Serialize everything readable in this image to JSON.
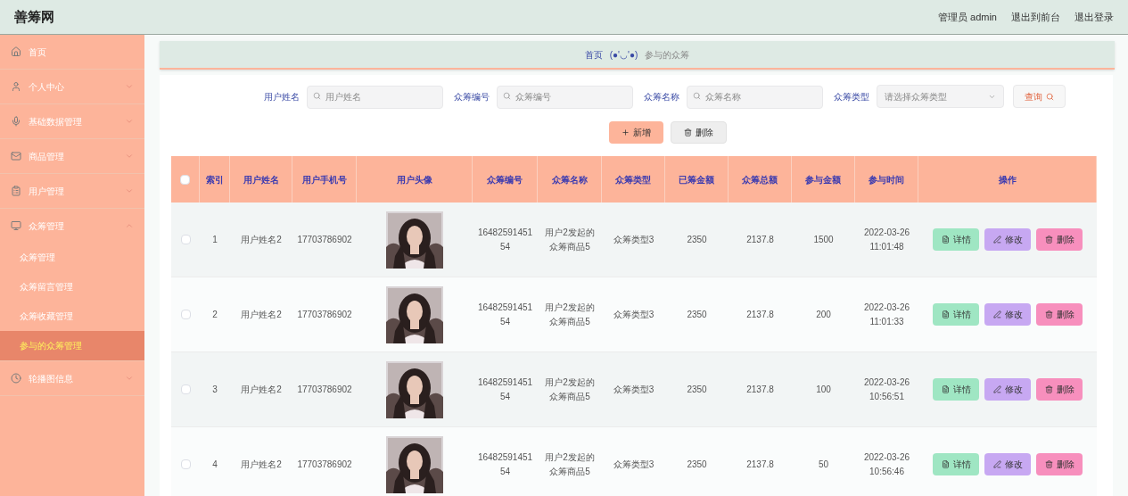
{
  "header": {
    "title": "善筹网",
    "links": [
      "管理员 admin",
      "退出到前台",
      "退出登录"
    ]
  },
  "sidebar": {
    "items": [
      {
        "label": "首页"
      },
      {
        "label": "个人中心",
        "expanded": false
      },
      {
        "label": "基础数据管理",
        "expanded": false
      },
      {
        "label": "商品管理",
        "expanded": false
      },
      {
        "label": "用户管理",
        "expanded": false
      },
      {
        "label": "众筹管理",
        "expanded": true,
        "children": [
          {
            "label": "众筹管理",
            "selected": false
          },
          {
            "label": "众筹留言管理",
            "selected": false
          },
          {
            "label": "众筹收藏管理",
            "selected": false
          },
          {
            "label": "参与的众筹管理",
            "selected": true
          }
        ]
      },
      {
        "label": "轮播图信息",
        "expanded": false
      }
    ]
  },
  "breadcrumb": {
    "home": "首页",
    "separator": "(●'◡'●)",
    "current": "参与的众筹"
  },
  "filters": [
    {
      "kind": "input",
      "label": "用户姓名",
      "placeholder": "用户姓名"
    },
    {
      "kind": "input",
      "label": "众筹编号",
      "placeholder": "众筹编号"
    },
    {
      "kind": "input",
      "label": "众筹名称",
      "placeholder": "众筹名称"
    },
    {
      "kind": "select",
      "label": "众筹类型",
      "placeholder": "请选择众筹类型"
    }
  ],
  "search_button": "查询",
  "actions": {
    "add": "新增",
    "delete": "删除"
  },
  "table": {
    "select_all_checked": false,
    "columns": [
      "索引",
      "用户姓名",
      "用户手机号",
      "用户头像",
      "众筹编号",
      "众筹名称",
      "众筹类型",
      "已筹金额",
      "众筹总额",
      "参与金额",
      "参与时间",
      "操作"
    ],
    "rows": [
      {
        "checked": false,
        "index": "1",
        "user_name": "用户姓名2",
        "phone": "17703786902",
        "avatar": {
          "kind": "picture"
        },
        "number": "1648259145154",
        "name": "用户2发起的众筹商品5",
        "type": "众筹类型3",
        "raised": "2350",
        "total": "2137.8",
        "amount": "1500",
        "time": "2022-03-26 11:01:48",
        "buttons": [
          "详情",
          "修改",
          "删除"
        ]
      },
      {
        "checked": false,
        "index": "2",
        "user_name": "用户姓名2",
        "phone": "17703786902",
        "avatar": {
          "kind": "picture"
        },
        "number": "1648259145154",
        "name": "用户2发起的众筹商品5",
        "type": "众筹类型3",
        "raised": "2350",
        "total": "2137.8",
        "amount": "200",
        "time": "2022-03-26 11:01:33",
        "buttons": [
          "详情",
          "修改",
          "删除"
        ]
      },
      {
        "checked": false,
        "index": "3",
        "user_name": "用户姓名2",
        "phone": "17703786902",
        "avatar": {
          "kind": "picture"
        },
        "number": "1648259145154",
        "name": "用户2发起的众筹商品5",
        "type": "众筹类型3",
        "raised": "2350",
        "total": "2137.8",
        "amount": "100",
        "time": "2022-03-26 10:56:51",
        "buttons": [
          "详情",
          "修改",
          "删除"
        ]
      },
      {
        "checked": false,
        "index": "4",
        "user_name": "用户姓名2",
        "phone": "17703786902",
        "avatar": {
          "kind": "picture"
        },
        "number": "1648259145154",
        "name": "用户2发起的众筹商品5",
        "type": "众筹类型3",
        "raised": "2350",
        "total": "2137.8",
        "amount": "50",
        "time": "2022-03-26 10:56:46",
        "buttons": [
          "详情",
          "修改",
          "删除"
        ]
      }
    ]
  }
}
